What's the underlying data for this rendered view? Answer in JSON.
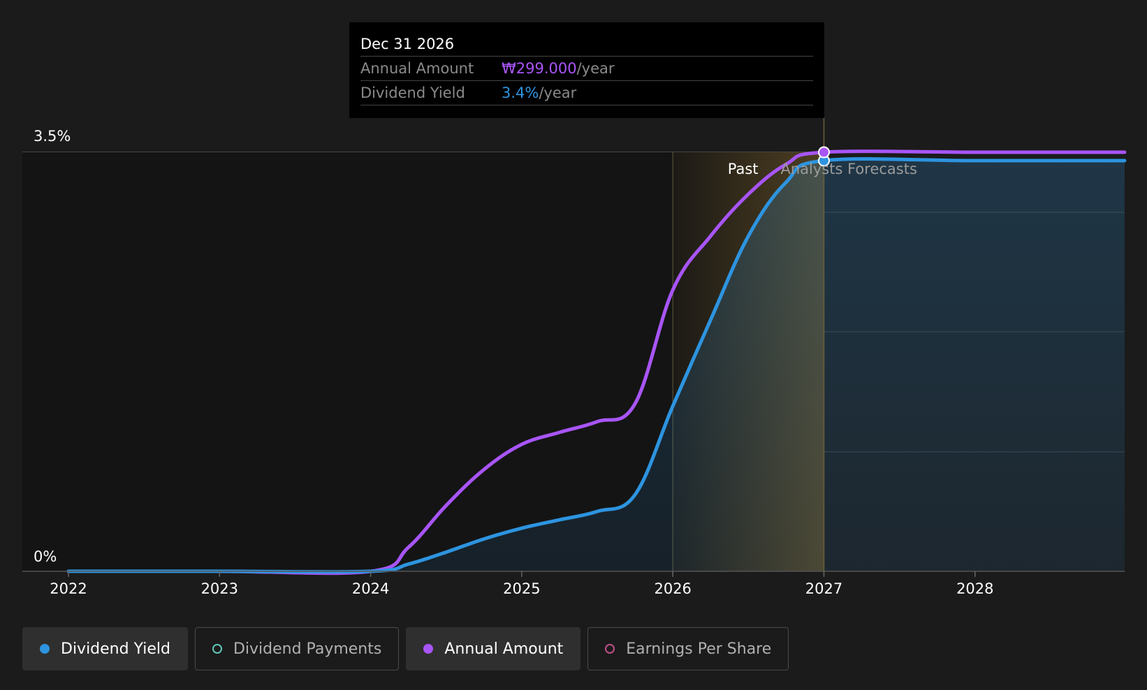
{
  "tooltip": {
    "date": "Dec 31 2026",
    "rows": [
      {
        "label": "Annual Amount",
        "value": "₩299.000",
        "unit": "/year"
      },
      {
        "label": "Dividend Yield",
        "value": "3.4%",
        "unit": "/year"
      }
    ]
  },
  "region_labels": {
    "past": "Past",
    "forecast": "Analysts Forecasts"
  },
  "colors": {
    "background": "#1b1b1b",
    "dividend_yield": "#2d94e0",
    "annual_amount": "#a855f7",
    "dividend_payments": "#5fc8b8",
    "earnings_per_share": "#c0508a",
    "past_band": "#d9a640"
  },
  "legend": [
    {
      "label": "Dividend Yield",
      "active": true,
      "color": "#2d94e0",
      "filled": true
    },
    {
      "label": "Dividend Payments",
      "active": false,
      "color": "#5fc8b8",
      "filled": false
    },
    {
      "label": "Annual Amount",
      "active": true,
      "color": "#a855f7",
      "filled": true
    },
    {
      "label": "Earnings Per Share",
      "active": false,
      "color": "#c0508a",
      "filled": false
    }
  ],
  "chart_data": {
    "type": "line",
    "title": "",
    "xlabel": "",
    "ylabel": "",
    "x_ticks": [
      "2022",
      "2023",
      "2024",
      "2025",
      "2026",
      "2027",
      "2028"
    ],
    "y_ticks": [
      "0%",
      "3.5%"
    ],
    "xlim": [
      2022,
      2029
    ],
    "ylim": [
      0,
      3.5
    ],
    "grid": true,
    "past_end": 2027,
    "highlight_start": 2026,
    "selected_x": 2027,
    "series": [
      {
        "name": "Annual Amount",
        "color": "#a855f7",
        "points": [
          [
            2022,
            0
          ],
          [
            2023,
            0
          ],
          [
            2024,
            0
          ],
          [
            2024.25,
            0.2
          ],
          [
            2024.5,
            0.55
          ],
          [
            2024.75,
            0.85
          ],
          [
            2025,
            1.06
          ],
          [
            2025.25,
            1.16
          ],
          [
            2025.5,
            1.25
          ],
          [
            2025.75,
            1.4
          ],
          [
            2026,
            2.35
          ],
          [
            2026.25,
            2.8
          ],
          [
            2026.5,
            3.15
          ],
          [
            2026.75,
            3.4
          ],
          [
            2027,
            3.5
          ],
          [
            2028,
            3.5
          ],
          [
            2028.99,
            3.5
          ]
        ]
      },
      {
        "name": "Dividend Yield",
        "color": "#2d94e0",
        "points": [
          [
            2022,
            0
          ],
          [
            2023,
            0
          ],
          [
            2024,
            0
          ],
          [
            2024.25,
            0.06
          ],
          [
            2024.5,
            0.16
          ],
          [
            2024.75,
            0.27
          ],
          [
            2025,
            0.36
          ],
          [
            2025.25,
            0.43
          ],
          [
            2025.5,
            0.5
          ],
          [
            2025.75,
            0.64
          ],
          [
            2026,
            1.38
          ],
          [
            2026.25,
            2.1
          ],
          [
            2026.5,
            2.8
          ],
          [
            2026.75,
            3.25
          ],
          [
            2027,
            3.43
          ],
          [
            2028,
            3.43
          ],
          [
            2028.99,
            3.43
          ]
        ]
      }
    ]
  }
}
